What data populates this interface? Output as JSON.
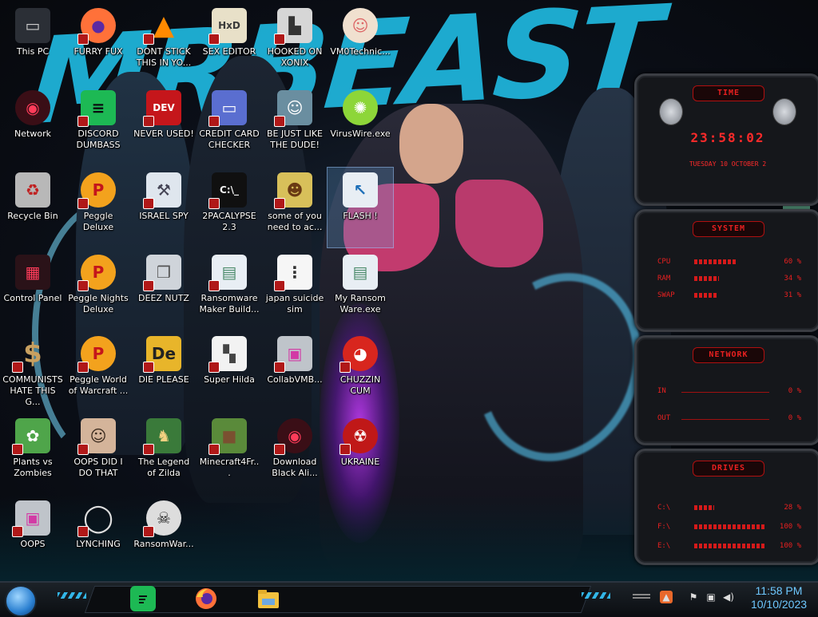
{
  "desktop": {
    "icons": [
      {
        "label": "This PC",
        "icon": "computer-icon",
        "shortcut": false
      },
      {
        "label": "FURRY FUX",
        "icon": "firefox-icon",
        "shortcut": true
      },
      {
        "label": "DONT STICK THIS IN YO...",
        "icon": "vlc-cone-icon",
        "shortcut": true
      },
      {
        "label": "SEX EDITOR",
        "icon": "hxd-icon",
        "shortcut": true
      },
      {
        "label": "HOOKED ON XONIX",
        "icon": "xonix-icon",
        "shortcut": true
      },
      {
        "label": "VM0Technic...",
        "icon": "technician-icon",
        "shortcut": false
      },
      {
        "label": "Network",
        "icon": "alien-network-icon",
        "shortcut": false
      },
      {
        "label": "DISCORD DUMBASS",
        "icon": "chat-icon",
        "shortcut": true
      },
      {
        "label": "NEVER USED!",
        "icon": "dev-plus-icon",
        "shortcut": true
      },
      {
        "label": "CREDIT CARD CHECKER",
        "icon": "credit-card-icon",
        "shortcut": true
      },
      {
        "label": "BE JUST LIKE THE DUDE!",
        "icon": "santa-icon",
        "shortcut": true
      },
      {
        "label": "VirusWire.exe",
        "icon": "lime-icon",
        "shortcut": false
      },
      {
        "label": "Recycle Bin",
        "icon": "recycle-bin-icon",
        "shortcut": false
      },
      {
        "label": "Peggle Deluxe",
        "icon": "peggle-icon",
        "shortcut": true
      },
      {
        "label": "ISRAEL SPY",
        "icon": "spy-tools-icon",
        "shortcut": true
      },
      {
        "label": "2PACALYPSE 2.3",
        "icon": "terminal-icon",
        "shortcut": true
      },
      {
        "label": "some of you need to ac...",
        "icon": "beaver-icon",
        "shortcut": true
      },
      {
        "label": "FLASH !",
        "icon": "flash-cursor-icon",
        "shortcut": false
      },
      {
        "label": "Control Panel",
        "icon": "control-panel-icon",
        "shortcut": false
      },
      {
        "label": "Peggle Nights Deluxe",
        "icon": "peggle-icon",
        "shortcut": true
      },
      {
        "label": "DEEZ NUTZ",
        "icon": "windows-stack-icon",
        "shortcut": true
      },
      {
        "label": "Ransomware Maker Build...",
        "icon": "app-window-icon",
        "shortcut": true
      },
      {
        "label": "japan suicide sim",
        "icon": "file-icon",
        "shortcut": true
      },
      {
        "label": "My Ransom Ware.exe",
        "icon": "app-window-icon",
        "shortcut": false
      },
      {
        "label": "COMMUNISTS HATE THIS G...",
        "icon": "money-bag-icon",
        "shortcut": true
      },
      {
        "label": "Peggle World of Warcraft ...",
        "icon": "peggle-icon",
        "shortcut": true
      },
      {
        "label": "DIE PLEASE",
        "icon": "de-icon",
        "shortcut": true
      },
      {
        "label": "Super Hilda",
        "icon": "pixel-hilda-icon",
        "shortcut": true
      },
      {
        "label": "CollabVMB...",
        "icon": "monitor-icon",
        "shortcut": true
      },
      {
        "label": "CHUZZIN CUM",
        "icon": "chuzzle-icon",
        "shortcut": true
      },
      {
        "label": "Plants vs Zombies",
        "icon": "plant-icon",
        "shortcut": true
      },
      {
        "label": "OOPS DID I DO THAT",
        "icon": "portrait-icon",
        "shortcut": true
      },
      {
        "label": "The Legend of Zilda",
        "icon": "zelda-icon",
        "shortcut": true
      },
      {
        "label": "Minecraft4Fr...",
        "icon": "grass-block-icon",
        "shortcut": true
      },
      {
        "label": "Download Black Ali...",
        "icon": "alien-network-icon",
        "shortcut": true
      },
      {
        "label": "UKRAINE",
        "icon": "radiation-icon",
        "shortcut": true
      },
      {
        "label": "OOPS",
        "icon": "monitor-icon",
        "shortcut": true
      },
      {
        "label": "LYNCHING",
        "icon": "noose-icon",
        "shortcut": true
      },
      {
        "label": "RansomWar...",
        "icon": "skull-icon",
        "shortcut": true
      }
    ],
    "selected_index": 17,
    "wallpaper_text": "MRBEAST"
  },
  "gadgets": {
    "clock": {
      "title": "TIME",
      "time": "23:58:02",
      "date": "TUESDAY 10 OCTOBER 2"
    },
    "system": {
      "title": "SYSTEM",
      "rows": [
        {
          "name": "CPU",
          "value": "60 %",
          "level": 0.6
        },
        {
          "name": "RAM",
          "value": "34 %",
          "level": 0.34
        },
        {
          "name": "SWAP",
          "value": "31 %",
          "level": 0.31
        }
      ]
    },
    "network": {
      "title": "NETWORK",
      "rows": [
        {
          "name": "IN",
          "value": "0 %"
        },
        {
          "name": "OUT",
          "value": "0 %"
        }
      ]
    },
    "drives": {
      "title": "DRIVES",
      "rows": [
        {
          "name": "C:\\",
          "value": "28 %",
          "level": 0.28
        },
        {
          "name": "F:\\",
          "value": "100 %",
          "level": 1.0
        },
        {
          "name": "E:\\",
          "value": "100 %",
          "level": 1.0
        }
      ]
    }
  },
  "taskbar": {
    "apps": [
      {
        "name": "chat-app",
        "color": "#1db954"
      },
      {
        "name": "firefox",
        "color": "#ff7139"
      },
      {
        "name": "file-explorer",
        "color": "#f3c13f"
      }
    ],
    "tray": [
      "volume-tray-icon",
      "network-tray-icon",
      "flag-tray-icon",
      "app-tray-icon"
    ],
    "clock": {
      "time": "11:58 PM",
      "date": "10/10/2023"
    }
  },
  "colors": {
    "gadget_red": "#e82020",
    "wallpaper_cyan": "#1fb3d9",
    "taskbar_accent": "#32b6e8"
  }
}
